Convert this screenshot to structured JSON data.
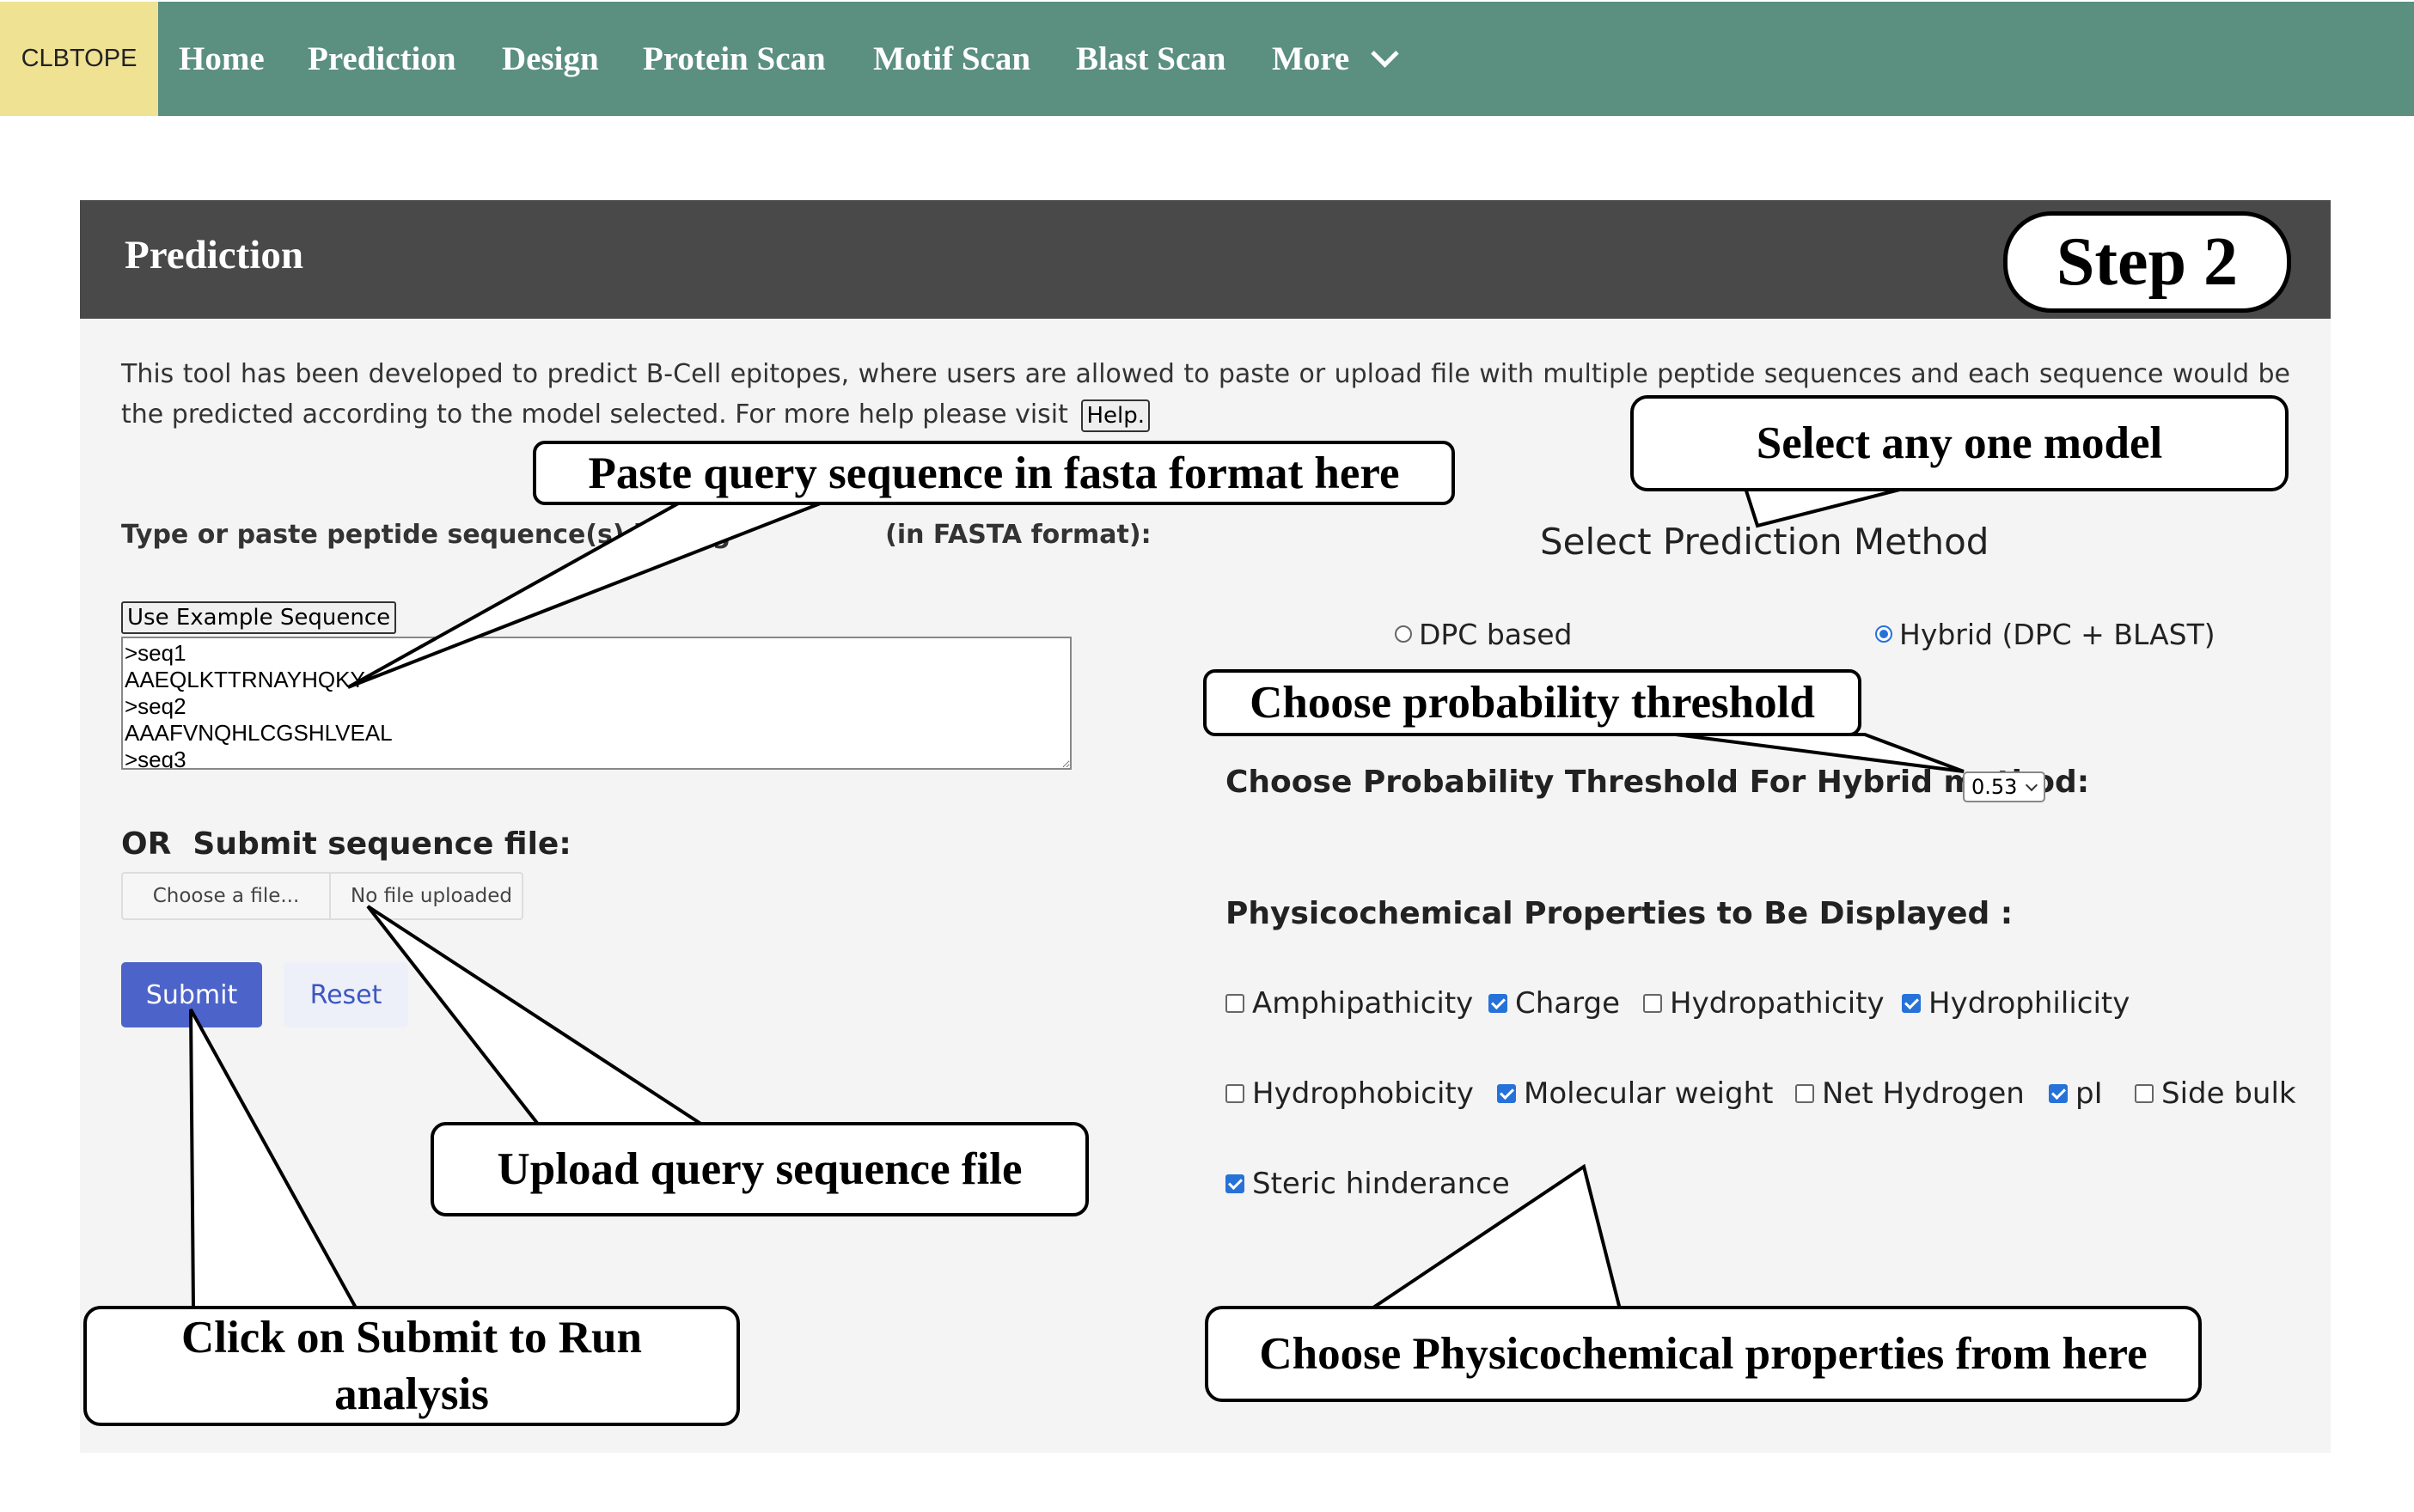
{
  "nav": {
    "brand": "CLBTOPE",
    "items": [
      "Home",
      "Prediction",
      "Design",
      "Protein Scan",
      "Motif Scan",
      "Blast Scan",
      "More"
    ]
  },
  "panel": {
    "title": "Prediction",
    "step": "Step 2",
    "description": "This tool has been developed to predict B-Cell epitopes, where users are allowed to paste or upload file with multiple peptide sequences and each sequence would be the predicted according to the model selected. For more help please visit",
    "help_link": "Help."
  },
  "left": {
    "seq_label_start": "Type or paste peptide sequence(s) in sing",
    "seq_label_end": "(in FASTA format):",
    "example_button": "Use Example Sequence",
    "sequence_lines": [
      ">seq1",
      "AAEQLKTTRNAYHQKY",
      ">seq2",
      "AAAFVNQHLCGSHLVEAL",
      ">seq3"
    ],
    "file_label": "OR  Submit sequence file:",
    "choose_file": "Choose a file...",
    "file_name": "No file uploaded",
    "submit": "Submit",
    "reset": "Reset"
  },
  "right": {
    "method_title": "Select Prediction Method",
    "methods": [
      {
        "label": "DPC based",
        "selected": false
      },
      {
        "label": "Hybrid (DPC + BLAST)",
        "selected": true
      }
    ],
    "threshold_label": "Choose Probability Threshold For Hybrid method:",
    "threshold_value": "0.53",
    "props_label": "Physicochemical Properties to Be Displayed :",
    "properties": [
      {
        "label": "Amphipathicity",
        "checked": false
      },
      {
        "label": "Charge",
        "checked": true
      },
      {
        "label": "Hydropathicity",
        "checked": false
      },
      {
        "label": "Hydrophilicity",
        "checked": true
      },
      {
        "label": "Hydrophobicity",
        "checked": false
      },
      {
        "label": "Molecular weight",
        "checked": true
      },
      {
        "label": "Net Hydrogen",
        "checked": false
      },
      {
        "label": "pI",
        "checked": true
      },
      {
        "label": "Side bulk",
        "checked": false
      },
      {
        "label": "Steric hinderance",
        "checked": true
      }
    ]
  },
  "callouts": {
    "paste": "Paste query sequence in fasta format here",
    "model": "Select any one model",
    "threshold": "Choose probability threshold",
    "upload": "Upload query sequence file",
    "submit_line1": "Click on Submit to Run",
    "submit_line2": "analysis",
    "props": "Choose Physicochemical properties from here"
  },
  "colors": {
    "nav_bg": "#5b8f80",
    "brand_bg": "#f0e293",
    "header_bg": "#494949",
    "panel_bg": "#f4f4f4",
    "submit_bg": "#4c63c9",
    "accent": "#2672d9"
  }
}
